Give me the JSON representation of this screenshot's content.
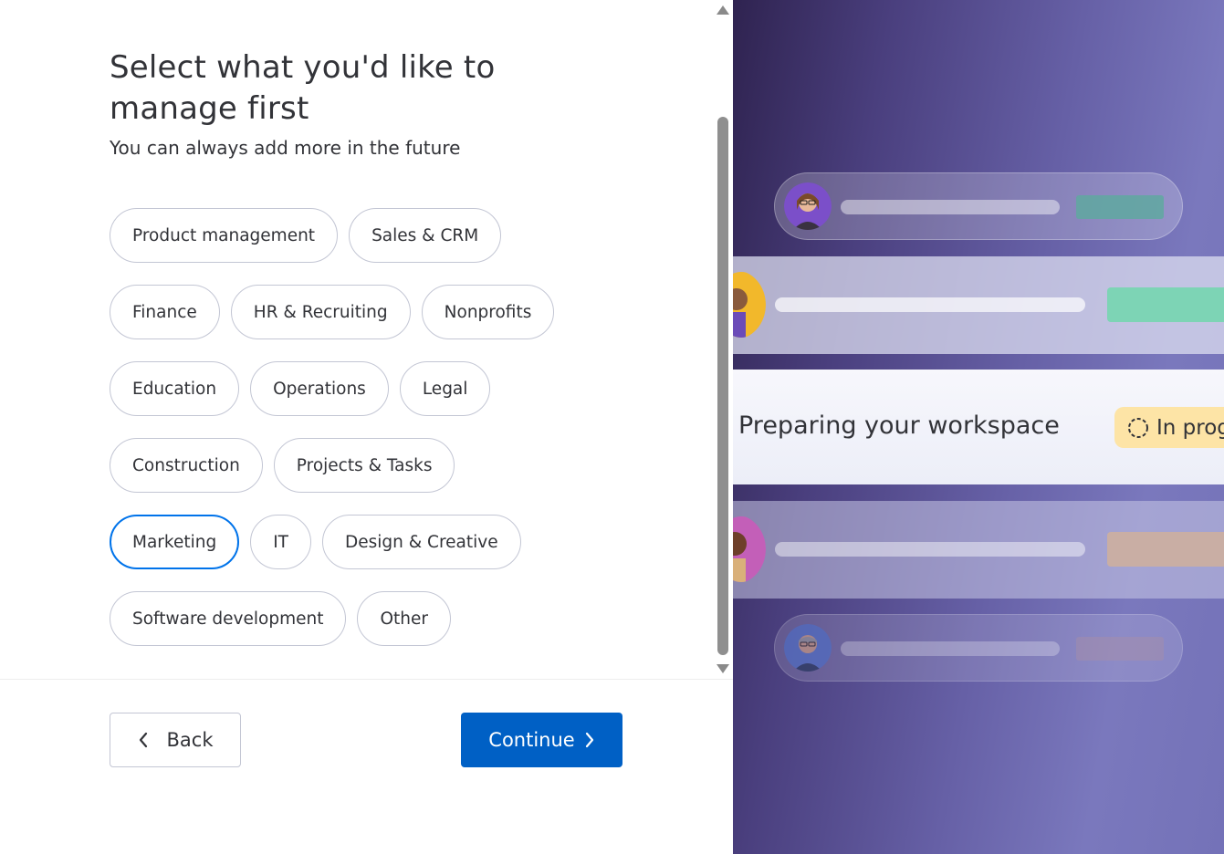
{
  "onboarding": {
    "heading": "Select what you'd like to manage first",
    "subheading": "You can always add more in the future",
    "chips": [
      [
        {
          "label": "Product management",
          "selected": false
        },
        {
          "label": "Sales & CRM",
          "selected": false
        }
      ],
      [
        {
          "label": "Finance",
          "selected": false
        },
        {
          "label": "HR & Recruiting",
          "selected": false
        },
        {
          "label": "Nonprofits",
          "selected": false
        }
      ],
      [
        {
          "label": "Education",
          "selected": false
        },
        {
          "label": "Operations",
          "selected": false
        },
        {
          "label": "Legal",
          "selected": false
        }
      ],
      [
        {
          "label": "Construction",
          "selected": false
        },
        {
          "label": "Projects & Tasks",
          "selected": false
        }
      ],
      [
        {
          "label": "Marketing",
          "selected": true
        },
        {
          "label": "IT",
          "selected": false
        },
        {
          "label": "Design & Creative",
          "selected": false
        }
      ],
      [
        {
          "label": "Software development",
          "selected": false
        },
        {
          "label": "Other",
          "selected": false
        }
      ]
    ]
  },
  "footer": {
    "back_label": "Back",
    "continue_label": "Continue"
  },
  "preview": {
    "workspace_label": "Preparing your workspace",
    "status_label": "In progress"
  },
  "colors": {
    "accent": "#0073ea",
    "primary_button": "#0060c5",
    "status_badge": "#fde4a6"
  }
}
